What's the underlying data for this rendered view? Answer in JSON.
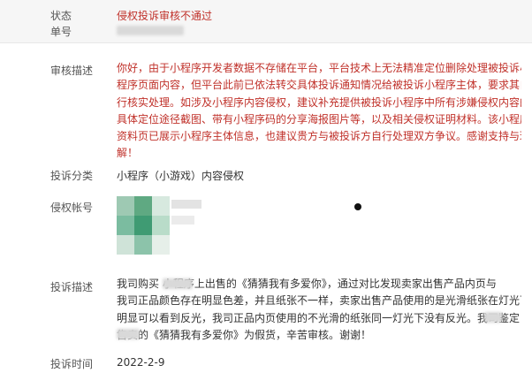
{
  "status": {
    "label": "状态",
    "value": "侵权投诉审核不通过"
  },
  "order": {
    "label": "单号"
  },
  "review": {
    "label": "审核描述",
    "lines": [
      "你好，由于小程序开发者数据不存储在平台，平台技术上无法精准定位删除处理被投诉小",
      "程序页面内容，但平台此前已依法转交具体投诉通知情况给被投诉小程序主体，要求其自",
      "行核实处理。如涉及小程序内容侵权，建议补充提供被投诉小程序中所有涉嫌侵权内容的",
      "具体定位途径截图、带有小程序码的分享海报图片等，以及相关侵权证明材料。该小程序",
      "资料页已展示小程序主体信息，也建议贵方与被投诉方自行处理双方争议。感谢支持与理",
      "解！"
    ]
  },
  "category": {
    "label": "投诉分类",
    "value": "小程序（小游戏）内容侵权"
  },
  "account": {
    "label": "侵权帐号"
  },
  "complaint": {
    "label": "投诉描述",
    "lines": [
      "我司购买          小程序上出售的《猜猜我有多爱你》，通过对比发现卖家出售产品内页与",
      "我司正品颜色存在明显色差，并且纸张不一样，卖家出售产品使用的是光滑纸张在灯光下",
      "明显可以看到反光，我司正品内页使用的不光滑的纸张同一灯光下没有反光。我司鉴定",
      "        售卖的《猜猜我有多爱你》为假货，辛苦审核。谢谢！"
    ]
  },
  "time": {
    "label": "投诉时间",
    "value": "2022-2-9"
  },
  "colors": {
    "accent_red": "#c0312a",
    "header_bg": "#f6f6f6"
  }
}
